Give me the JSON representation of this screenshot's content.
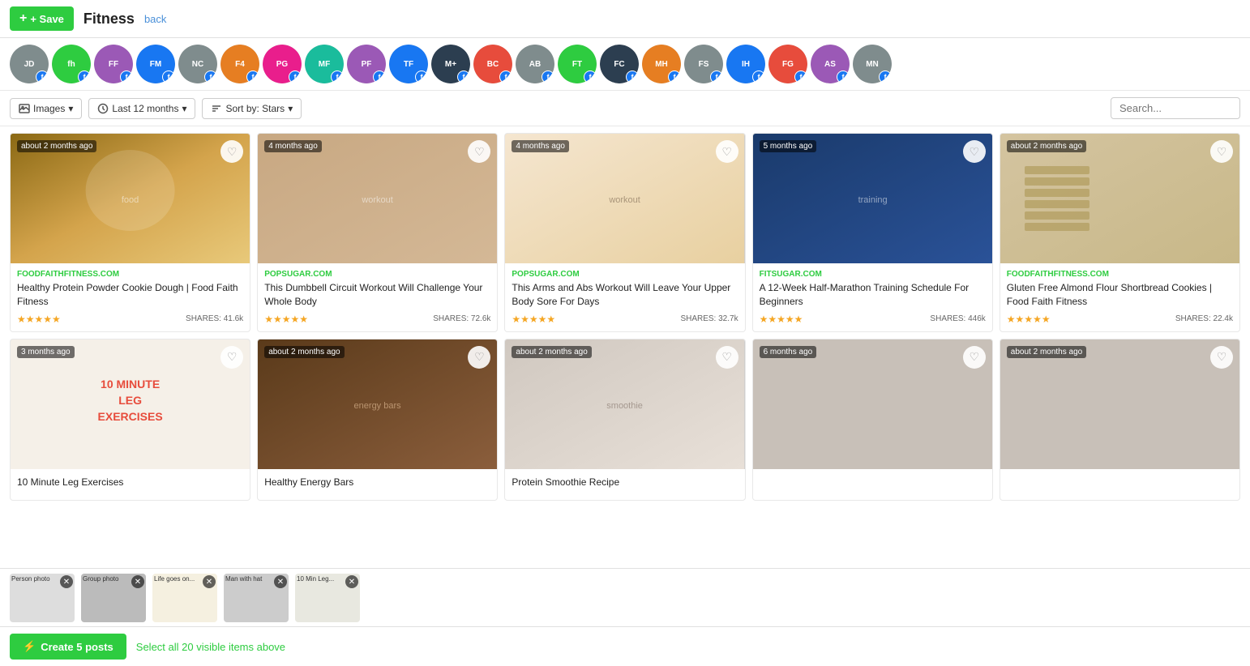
{
  "header": {
    "save_label": "+ Save",
    "title": "Fitness",
    "back_label": "back"
  },
  "toolbar": {
    "images_label": "Images",
    "time_label": "Last 12 months",
    "sort_label": "Sort by: Stars",
    "search_placeholder": "Search..."
  },
  "bottom_bar": {
    "create_label": "Create 5 posts",
    "select_all_label": "Select all 20 visible items above"
  },
  "cards": [
    {
      "timestamp": "about 2 months ago",
      "source": "FOODFAITHFITNESS.COM",
      "title": "Healthy Protein Powder Cookie Dough | Food Faith Fitness",
      "stars": "★★★★★",
      "shares": "SHARES: 41.6k",
      "img_class": "img-food1"
    },
    {
      "timestamp": "4 months ago",
      "source": "POPSUGAR.COM",
      "title": "This Dumbbell Circuit Workout Will Challenge Your Whole Body",
      "stars": "★★★★★",
      "shares": "SHARES: 72.6k",
      "img_class": "img-workout1"
    },
    {
      "timestamp": "4 months ago",
      "source": "POPSUGAR.COM",
      "title": "This Arms and Abs Workout Will Leave Your Upper Body Sore For Days",
      "stars": "★★★★★",
      "shares": "SHARES: 32.7k",
      "img_class": "img-workout2"
    },
    {
      "timestamp": "5 months ago",
      "source": "FITSUGAR.COM",
      "title": "A 12-Week Half-Marathon Training Schedule For Beginners",
      "stars": "★★★★★",
      "shares": "SHARES: 446k",
      "img_class": "img-blue1"
    },
    {
      "timestamp": "about 2 months ago",
      "source": "FOODFAITHFITNESS.COM",
      "title": "Gluten Free Almond Flour Shortbread Cookies | Food Faith Fitness",
      "stars": "★★★★★",
      "shares": "SHARES: 22.4k",
      "img_class": "img-crackers"
    },
    {
      "timestamp": "3 months ago",
      "source": "",
      "title": "10 Minute Leg Exercises",
      "stars": "",
      "shares": "",
      "img_class": "img-legs"
    },
    {
      "timestamp": "about 2 months ago",
      "source": "",
      "title": "Healthy Energy Bars",
      "stars": "",
      "shares": "",
      "img_class": "img-bars"
    },
    {
      "timestamp": "about 2 months ago",
      "source": "",
      "title": "Protein Smoothie Recipe",
      "stars": "",
      "shares": "",
      "img_class": "img-smoothie"
    },
    {
      "timestamp": "6 months ago",
      "source": "",
      "title": "",
      "stars": "",
      "shares": "",
      "img_class": "img-partial"
    },
    {
      "timestamp": "about 2 months ago",
      "source": "",
      "title": "",
      "stars": "",
      "shares": "",
      "img_class": "img-partial"
    }
  ],
  "selected_strip": [
    {
      "label": "Person photo"
    },
    {
      "label": "Group photo"
    },
    {
      "label": "Life goes on..."
    },
    {
      "label": "Man with hat"
    },
    {
      "label": "10 Min Leg..."
    }
  ],
  "avatars": [
    {
      "initials": "JD",
      "color": "av-gray"
    },
    {
      "initials": "fh",
      "color": "av-green"
    },
    {
      "initials": "FF",
      "color": "av-purple"
    },
    {
      "initials": "FM",
      "color": "av-blue"
    },
    {
      "initials": "NC",
      "color": "av-gray"
    },
    {
      "initials": "F4",
      "color": "av-orange"
    },
    {
      "initials": "PG",
      "color": "av-pink"
    },
    {
      "initials": "MF",
      "color": "av-teal"
    },
    {
      "initials": "PF",
      "color": "av-purple"
    },
    {
      "initials": "TF",
      "color": "av-blue"
    },
    {
      "initials": "M+",
      "color": "av-dark"
    },
    {
      "initials": "BC",
      "color": "av-red"
    },
    {
      "initials": "AB",
      "color": "av-gray"
    },
    {
      "initials": "FT",
      "color": "av-green"
    },
    {
      "initials": "FC",
      "color": "av-dark"
    },
    {
      "initials": "MH",
      "color": "av-orange"
    },
    {
      "initials": "FS",
      "color": "av-gray"
    },
    {
      "initials": "IH",
      "color": "av-blue"
    },
    {
      "initials": "FG",
      "color": "av-red"
    },
    {
      "initials": "AS",
      "color": "av-purple"
    },
    {
      "initials": "MN",
      "color": "av-gray"
    }
  ]
}
